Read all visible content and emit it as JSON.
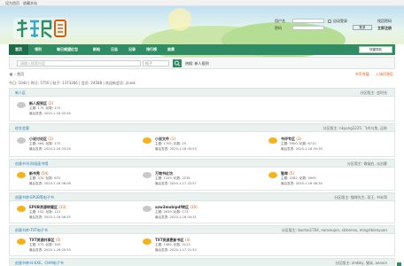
{
  "topbar": {
    "home": "设为首页",
    "fav": "收藏本站"
  },
  "login": {
    "user_label": "用户名",
    "auto_login": "自动登录",
    "retrieve": "找回密码",
    "pass_label": "密码",
    "login_btn": "登录",
    "register_btn": "立即注册"
  },
  "nav": {
    "items": [
      "首页",
      "领利",
      "每日威望红包",
      "新帖",
      "日志",
      "记录",
      "排行榜",
      "勋章"
    ],
    "active": 0,
    "quick": "快捷导航"
  },
  "search": {
    "placeholder": "请输入搜索内容",
    "type": "帖子",
    "hot_label": "热搜:",
    "hot_words": "新人报到"
  },
  "crumb": "首页",
  "links": {
    "award": "书币充值",
    "new": "入场问答区"
  },
  "stats": {
    "today": "今日: 1040",
    "yesterday": "昨日: 5750",
    "posts": "帖子: 1373266",
    "members": "会员: 24588",
    "welcome": "欢迎新会员: jiruek"
  },
  "sections": [
    {
      "title": "新人区",
      "mod": "分区版主: 会时光",
      "forums": [
        {
          "name": "新人报到区",
          "count": "(2)",
          "topics": "主题: 175, 帖数: 175",
          "last": "最后发表: 2020-1-16 05:34",
          "color": "gray"
        }
      ]
    },
    {
      "title": "综艺会客",
      "mod": "分区版主: nkyong1225, 飞鸟与鱼, 远秋",
      "forums": [
        {
          "name": "小说讨论区",
          "count": "(1)",
          "topics": "主题: 464, 帖数: 175",
          "last": "最后发表: 2020-1-16 03:25",
          "color": "gray"
        },
        {
          "name": "小说文件",
          "count": "(1)",
          "topics": "主题: 1705, 帖数: 25",
          "last": "最后发表: 2020-1-16 05:53",
          "color": "gold"
        },
        {
          "name": "书评专区",
          "count": "(3)",
          "topics": "主题: 5900, 帖数: 6710",
          "last": "最后发表: 2020-1-16 05:39",
          "color": "gold"
        }
      ]
    },
    {
      "title": "创意书刊·阶段面书馆",
      "mod": "分区版主: 微烟白, 淡泊客",
      "forums": [
        {
          "name": "新书秀",
          "count": "(54)",
          "topics": "主题: 370, 帖数: 675",
          "last": "最后发表: 2020-1-16 06:06",
          "color": "gold"
        },
        {
          "name": "万物书红坊",
          "count": "",
          "topics": "主题: 1259, 帖数: 2234",
          "last": "最后发表: 2020-1-17 22:57",
          "color": "gray"
        },
        {
          "name": "智库",
          "count": "(5)",
          "topics": "主题: 2282, 帖数: 4909",
          "last": "最后发表: 2020-1-16 06:34",
          "color": "gold"
        }
      ]
    },
    {
      "title": "创意书库·EPUB等电子书",
      "mod": "分区版主: 猫咪先生, 双王, 书米哥",
      "forums": [
        {
          "name": "EPUB资源转载区",
          "count": "(13)",
          "topics": "主题: 102, 帖数: 113",
          "last": "最后发表: 2020-1-16 06:35",
          "color": "gold"
        },
        {
          "name": "azw3mobipdf转区",
          "count": "(10)",
          "topics": "主题: 2639, 帖数: 173",
          "last": "最后发表: 2020-1-16 04:31",
          "color": "gray"
        }
      ]
    },
    {
      "title": "创意书库·TXT电子书",
      "mod": "分区版主: bachai1764, nanseujon, skleenso, mingribianyuan",
      "forums": [
        {
          "name": "TXT资源共享区",
          "count": "(5)",
          "topics": "主题: 375, 帖数: 305",
          "last": "最后发表: 2020-1-16 05:53",
          "color": "gold"
        },
        {
          "name": "TXT资源更新书区",
          "count": "(4)",
          "topics": "主题: 1489, 帖数: 5123",
          "last": "最后发表: 2020-1-17 21:53",
          "color": "gold"
        }
      ]
    },
    {
      "title": "创意书库·H-EXE、CHM电子书",
      "mod": "分区版主: zmbby, 猫米, aenxin",
      "forums": []
    }
  ],
  "colors": {
    "nav": "#2f8c63",
    "link": "#2d7bb5",
    "accent": "#e35b00"
  }
}
